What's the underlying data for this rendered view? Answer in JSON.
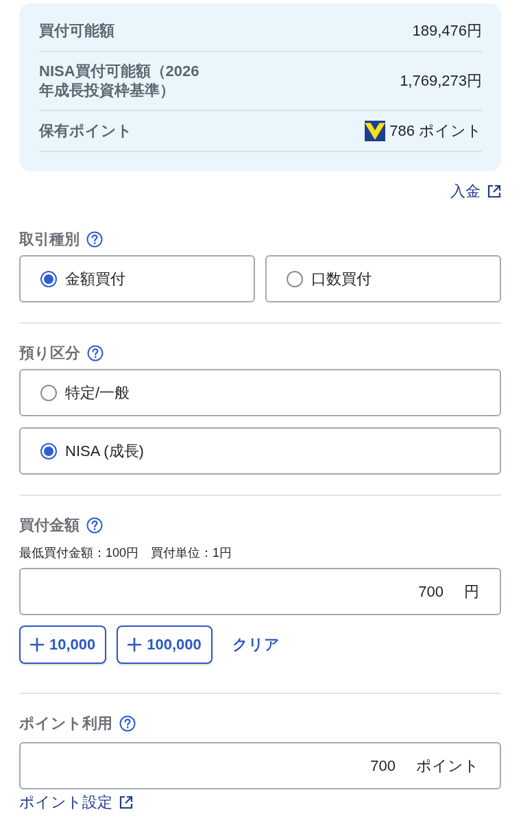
{
  "summary": {
    "rows": [
      {
        "kind": "amount",
        "label": "買付可能額",
        "value": "189,476円"
      },
      {
        "kind": "amount",
        "label": "NISA買付可能額（2026年成長投資枠基準）",
        "value": "1,769,273円"
      },
      {
        "kind": "points",
        "label": "保有ポイント",
        "value": "786 ポイント"
      }
    ]
  },
  "deposit_link": {
    "label": "入金"
  },
  "sections": [
    {
      "kind": "radio_row",
      "title": "取引種別",
      "options": [
        {
          "label": "金額買付",
          "selected": true
        },
        {
          "label": "口数買付",
          "selected": false
        }
      ]
    },
    {
      "kind": "radio_list",
      "title": "預り区分",
      "options": [
        {
          "label": "特定/一般",
          "selected": false
        },
        {
          "label": "NISA (成長)",
          "selected": true
        }
      ]
    },
    {
      "kind": "amount",
      "title": "買付金額",
      "hint": "最低買付金額：100円　買付単位：1円",
      "input": {
        "value": "700",
        "unit": "円"
      },
      "quick_buttons": [
        {
          "label": "10,000"
        },
        {
          "label": "100,000"
        }
      ],
      "clear_link": "クリア"
    },
    {
      "kind": "points",
      "title": "ポイント利用",
      "input": {
        "value": "700",
        "unit": "ポイント"
      },
      "link": "ポイント設定"
    }
  ]
}
